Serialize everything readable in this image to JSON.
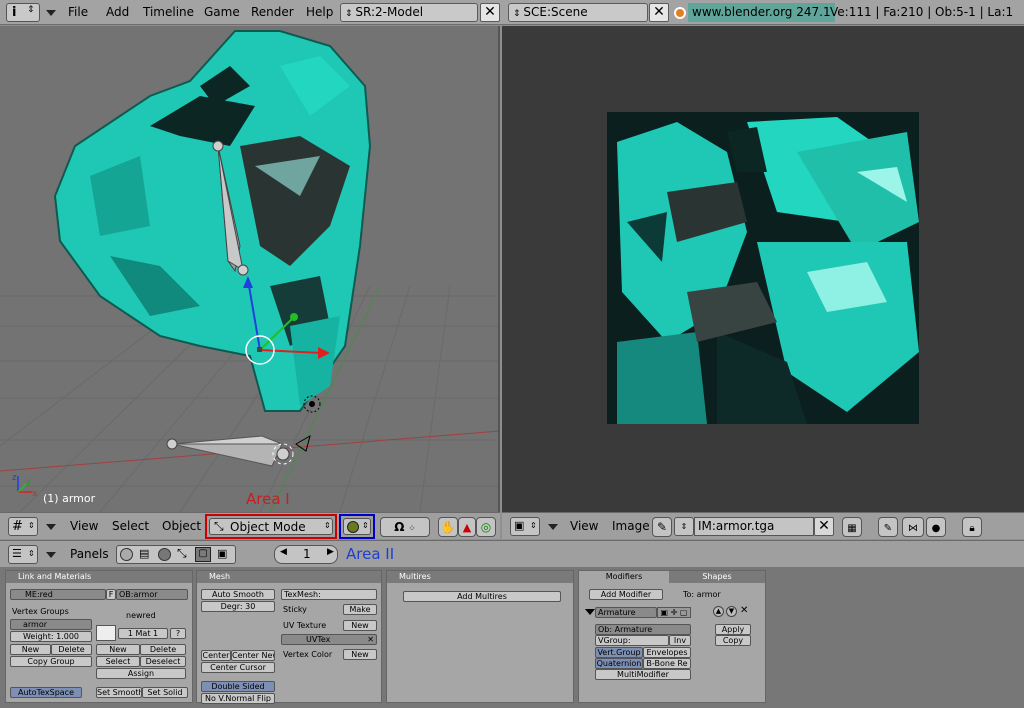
{
  "topbar": {
    "menus": [
      "File",
      "Add",
      "Timeline",
      "Game",
      "Render",
      "Help"
    ],
    "screen": "SR:2-Model",
    "scene": "SCE:Scene",
    "version": "www.blender.org 247.1",
    "stats": "Ve:111 | Fa:210 | Ob:5-1 | La:1"
  },
  "view3d": {
    "object_label": "(1) armor",
    "axes": {
      "x": "x",
      "y": "y",
      "z": "z"
    }
  },
  "view3d_header": {
    "view": "View",
    "select": "Select",
    "object": "Object",
    "mode": "Object Mode"
  },
  "annotations": {
    "area1": "Area I",
    "area2": "Area II"
  },
  "image_header": {
    "view": "View",
    "image": "Image",
    "image_name": "IM:armor.tga"
  },
  "buttons_header": {
    "panels": "Panels",
    "frame": "1"
  },
  "link_materials": {
    "title": "Link and Materials",
    "me": "ME:red",
    "f": "F",
    "ob": "OB:armor",
    "vertex_groups": "Vertex Groups",
    "group_name": "armor",
    "weight": "Weight: 1.000",
    "new": "New",
    "delete": "Delete",
    "copy_group": "Copy Group",
    "mat_name": "newred",
    "mat_index": "1 Mat 1",
    "mat_q": "?",
    "mat_new": "New",
    "mat_delete": "Delete",
    "select": "Select",
    "deselect": "Deselect",
    "assign": "Assign",
    "autotex": "AutoTexSpace",
    "set_smooth": "Set Smooth",
    "set_solid": "Set Solid"
  },
  "mesh": {
    "title": "Mesh",
    "auto_smooth": "Auto Smooth",
    "degr": "Degr: 30",
    "texmesh": "TexMesh:",
    "sticky": "Sticky",
    "make": "Make",
    "uv_texture": "UV Texture",
    "new": "New",
    "uvtex": "UVTex",
    "vertex_color": "Vertex Color",
    "new2": "New",
    "center": "Center",
    "center_new": "Center New",
    "center_cursor": "Center Cursor",
    "double_sided": "Double Sided",
    "no_vnormal_flip": "No V.Normal Flip"
  },
  "multires": {
    "title": "Multires",
    "add_multires": "Add Multires"
  },
  "modifiers": {
    "tab_modifiers": "Modifiers",
    "tab_shapes": "Shapes",
    "add_modifier": "Add Modifier",
    "to": "To: armor",
    "name": "Armature",
    "ob": "Ob: Armature",
    "vgroup": "VGroup:",
    "inv": "Inv",
    "vert_group": "Vert.Group",
    "envelopes": "Envelopes",
    "quaternion": "Quaternion",
    "bbone": "B-Bone Re",
    "multimodifier": "MultiModifier",
    "apply": "Apply",
    "copy": "Copy"
  },
  "colors": {
    "accent_red": "#cc0000",
    "accent_blue": "#0000cc",
    "mesh_cyan": "#1fc8b4",
    "annot_blue": "#1e3fd0",
    "annot_red": "#c81e1e"
  }
}
